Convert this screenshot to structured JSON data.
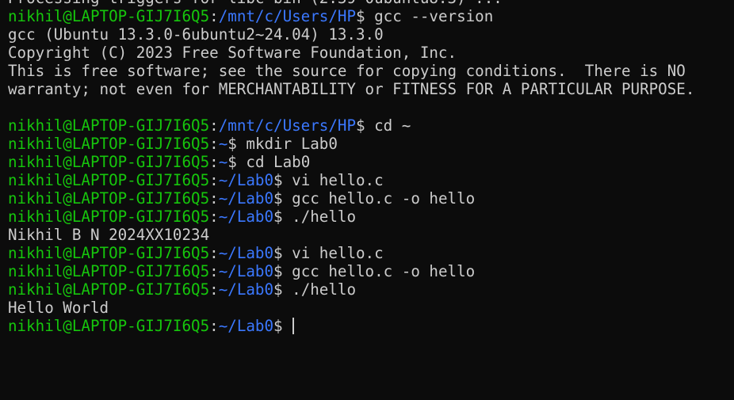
{
  "terminal": {
    "colors": {
      "background": "#0c0c0c",
      "text": "#cccccc",
      "user_host": "#16c60c",
      "path": "#3b78ff"
    },
    "lines": [
      {
        "kind": "output",
        "text": "Processing triggers for libc-bin (2.39-0ubuntu8.3) ..."
      },
      {
        "kind": "prompt",
        "user": "nikhil@LAPTOP-GIJ7I6Q5",
        "path": "/mnt/c/Users/HP",
        "cmd": " gcc --version"
      },
      {
        "kind": "output",
        "text": "gcc (Ubuntu 13.3.0-6ubuntu2~24.04) 13.3.0"
      },
      {
        "kind": "output",
        "text": "Copyright (C) 2023 Free Software Foundation, Inc."
      },
      {
        "kind": "output",
        "text": "This is free software; see the source for copying conditions.  There is NO"
      },
      {
        "kind": "output",
        "text": "warranty; not even for MERCHANTABILITY or FITNESS FOR A PARTICULAR PURPOSE."
      },
      {
        "kind": "output",
        "text": ""
      },
      {
        "kind": "prompt",
        "user": "nikhil@LAPTOP-GIJ7I6Q5",
        "path": "/mnt/c/Users/HP",
        "cmd": " cd ~"
      },
      {
        "kind": "prompt",
        "user": "nikhil@LAPTOP-GIJ7I6Q5",
        "path": "~",
        "cmd": " mkdir Lab0"
      },
      {
        "kind": "prompt",
        "user": "nikhil@LAPTOP-GIJ7I6Q5",
        "path": "~",
        "cmd": " cd Lab0"
      },
      {
        "kind": "prompt",
        "user": "nikhil@LAPTOP-GIJ7I6Q5",
        "path": "~/Lab0",
        "cmd": " vi hello.c"
      },
      {
        "kind": "prompt",
        "user": "nikhil@LAPTOP-GIJ7I6Q5",
        "path": "~/Lab0",
        "cmd": " gcc hello.c -o hello"
      },
      {
        "kind": "prompt",
        "user": "nikhil@LAPTOP-GIJ7I6Q5",
        "path": "~/Lab0",
        "cmd": " ./hello"
      },
      {
        "kind": "output",
        "text": "Nikhil B N 2024XX10234"
      },
      {
        "kind": "prompt",
        "user": "nikhil@LAPTOP-GIJ7I6Q5",
        "path": "~/Lab0",
        "cmd": " vi hello.c"
      },
      {
        "kind": "prompt",
        "user": "nikhil@LAPTOP-GIJ7I6Q5",
        "path": "~/Lab0",
        "cmd": " gcc hello.c -o hello"
      },
      {
        "kind": "prompt",
        "user": "nikhil@LAPTOP-GIJ7I6Q5",
        "path": "~/Lab0",
        "cmd": " ./hello"
      },
      {
        "kind": "output",
        "text": "Hello World"
      },
      {
        "kind": "prompt",
        "user": "nikhil@LAPTOP-GIJ7I6Q5",
        "path": "~/Lab0",
        "cmd": " ",
        "cursor": true
      }
    ]
  }
}
